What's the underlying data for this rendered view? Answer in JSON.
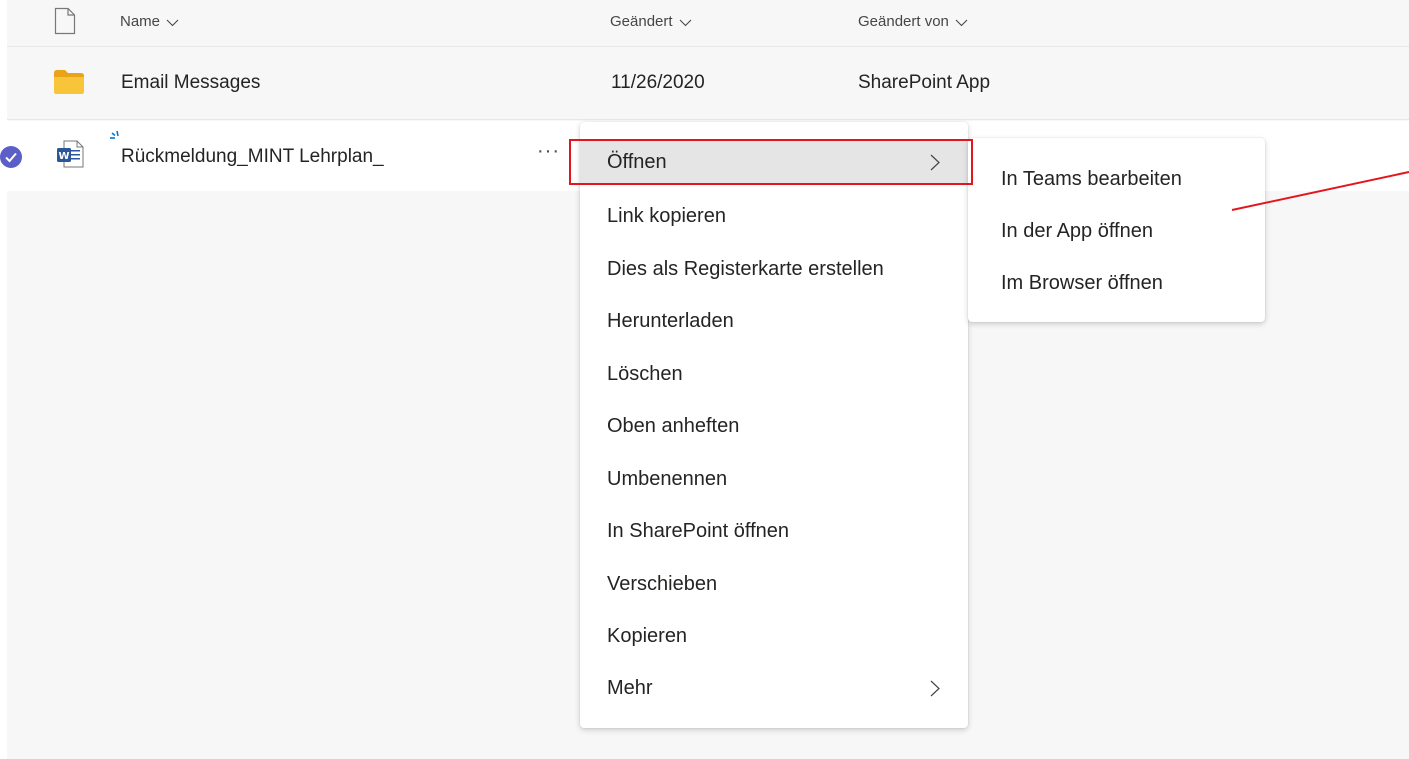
{
  "columns": {
    "name": "Name",
    "modified": "Geändert",
    "modified_by": "Geändert von"
  },
  "rows": [
    {
      "name": "Email Messages",
      "modified": "11/26/2020",
      "modified_by": "SharePoint App",
      "icon": "folder-icon"
    },
    {
      "name": "Rückmeldung_MINT Lehrplan_",
      "icon": "word-document-icon",
      "more": "···"
    }
  ],
  "context_menu": {
    "items": [
      {
        "label": "Öffnen",
        "submenu": true
      },
      {
        "label": "Link kopieren"
      },
      {
        "label": "Dies als Registerkarte erstellen"
      },
      {
        "label": "Herunterladen"
      },
      {
        "label": "Löschen"
      },
      {
        "label": "Oben anheften"
      },
      {
        "label": "Umbenennen"
      },
      {
        "label": "In SharePoint öffnen"
      },
      {
        "label": "Verschieben"
      },
      {
        "label": "Kopieren"
      },
      {
        "label": "Mehr",
        "submenu": true
      }
    ]
  },
  "submenu": {
    "items": [
      {
        "label": "In Teams bearbeiten"
      },
      {
        "label": "In der App öffnen"
      },
      {
        "label": "Im Browser öffnen"
      }
    ]
  },
  "colors": {
    "highlight": "#e3161d",
    "folder": "#f8c53a",
    "word": "#2b579a",
    "check": "#5b5fc7",
    "sync": "#0078d4"
  }
}
